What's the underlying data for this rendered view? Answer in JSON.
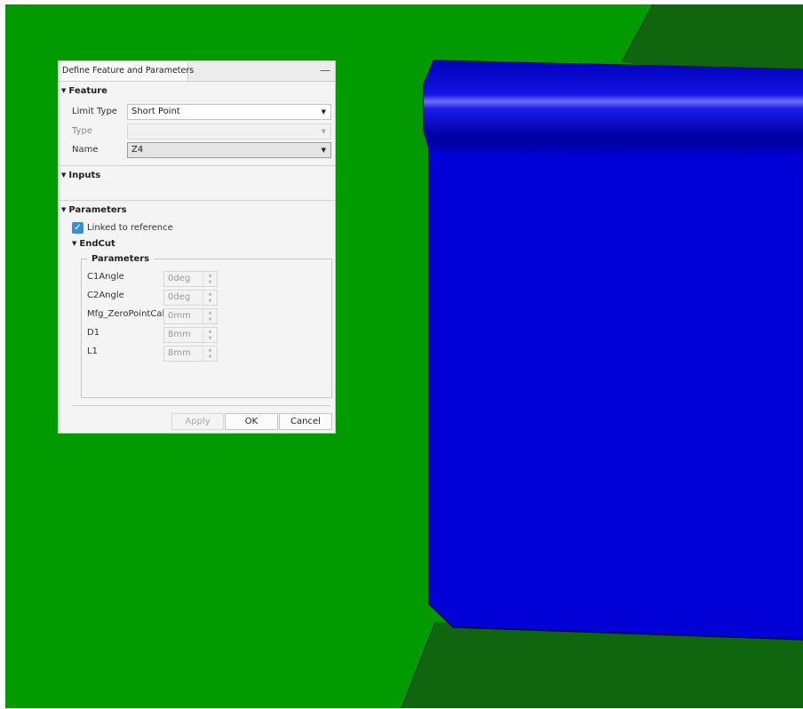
{
  "dialog": {
    "title": "Define Feature and Parameters",
    "minimize_glyph": "—",
    "feature": {
      "heading": "Feature",
      "limit_type_label": "Limit Type",
      "limit_type_value": "Short Point",
      "type_label": "Type",
      "type_value": "",
      "name_label": "Name",
      "name_value": "Z4"
    },
    "inputs": {
      "heading": "Inputs"
    },
    "parameters": {
      "heading": "Parameters",
      "linked_label": "Linked to reference",
      "linked_checked": true,
      "endcut_heading": "EndCut",
      "group_title": "Parameters",
      "rows": [
        {
          "label": "C1Angle",
          "value": "0deg"
        },
        {
          "label": "C2Angle",
          "value": "0deg"
        },
        {
          "label": "Mfg_ZeroPointCalc",
          "value": "0mm"
        },
        {
          "label": "D1",
          "value": "8mm"
        },
        {
          "label": "L1",
          "value": "8mm"
        }
      ]
    },
    "buttons": {
      "apply": "Apply",
      "ok": "OK",
      "cancel": "Cancel"
    }
  },
  "icons": {
    "section_toggle": "triangle-down-icon",
    "checkbox_mark": "check-icon",
    "dropdown": "chevron-down-icon"
  },
  "colors": {
    "background_green": "#019A01",
    "dark_green": "#0F660F",
    "part_blue": "#0000D6",
    "accent": "#3B8FD8"
  }
}
